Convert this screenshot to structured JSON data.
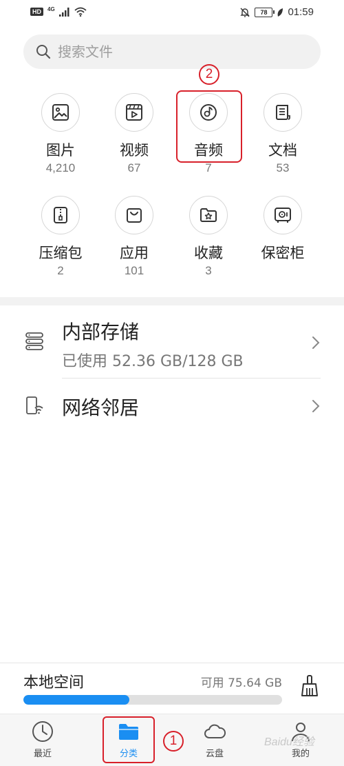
{
  "status_bar": {
    "hd": "HD",
    "network": "4G",
    "battery": "78",
    "time": "01:59"
  },
  "search": {
    "placeholder": "搜索文件",
    "icon": "search-icon"
  },
  "categories": [
    {
      "label": "图片",
      "count": "4,210",
      "icon": "image-icon"
    },
    {
      "label": "视频",
      "count": "67",
      "icon": "video-icon"
    },
    {
      "label": "音频",
      "count": "7",
      "icon": "audio-icon"
    },
    {
      "label": "文档",
      "count": "53",
      "icon": "document-icon"
    },
    {
      "label": "压缩包",
      "count": "2",
      "icon": "archive-icon"
    },
    {
      "label": "应用",
      "count": "101",
      "icon": "app-bag-icon"
    },
    {
      "label": "收藏",
      "count": "3",
      "icon": "favorite-folder-icon"
    },
    {
      "label": "保密柜",
      "count": "",
      "icon": "safe-icon"
    }
  ],
  "annotations": {
    "marker_1": "1",
    "marker_2": "2"
  },
  "storage": {
    "internal": {
      "title": "内部存储",
      "usage": "已使用 52.36 GB/128 GB",
      "icon": "storage-icon"
    },
    "network": {
      "title": "网络邻居",
      "icon": "network-neighbor-icon"
    }
  },
  "local_space": {
    "title": "本地空间",
    "free": "可用 75.64 GB",
    "used_fraction": 0.41,
    "bar_color": "#1a8ef2",
    "clean_icon": "broom-icon"
  },
  "nav": {
    "items": [
      {
        "label": "最近",
        "icon": "clock-icon"
      },
      {
        "label": "分类",
        "icon": "folder-icon",
        "active": true
      },
      {
        "label": "云盘",
        "icon": "cloud-icon"
      },
      {
        "label": "我的",
        "icon": "profile-icon"
      }
    ]
  },
  "watermark": "Baidu经验",
  "colors": {
    "accent": "#1a8ef2",
    "annotation_red": "#d8202a"
  }
}
